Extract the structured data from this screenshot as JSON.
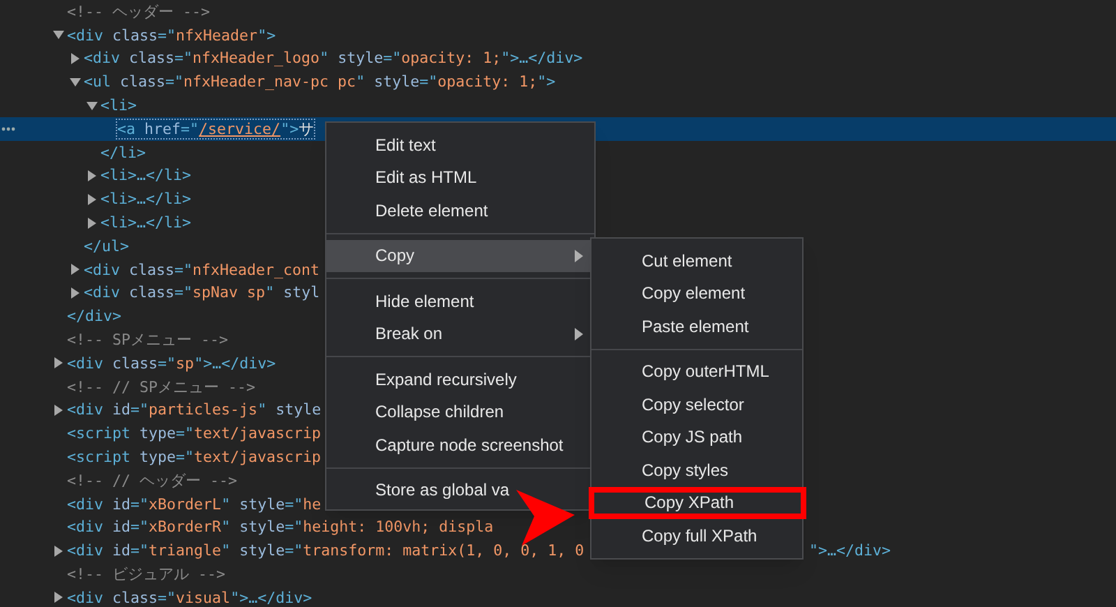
{
  "tree": [
    {
      "tokens": [
        {
          "kind": "comment",
          "text": "<!-- ヘッダー -->"
        }
      ]
    },
    {
      "expanded": true,
      "tokens": [
        {
          "kind": "tag",
          "text": "<div "
        },
        {
          "kind": "attr",
          "text": "class"
        },
        {
          "kind": "tag",
          "text": "=\""
        },
        {
          "kind": "value",
          "text": "nfxHeader"
        },
        {
          "kind": "tag",
          "text": "\">"
        }
      ],
      "close_tokens": [
        {
          "kind": "tag",
          "text": "</div>"
        }
      ],
      "children": [
        {
          "expanded": false,
          "tokens": [
            {
              "kind": "tag",
              "text": "<div "
            },
            {
              "kind": "attr",
              "text": "class"
            },
            {
              "kind": "tag",
              "text": "=\""
            },
            {
              "kind": "value",
              "text": "nfxHeader_logo"
            },
            {
              "kind": "tag",
              "text": "\" "
            },
            {
              "kind": "attr",
              "text": "style"
            },
            {
              "kind": "tag",
              "text": "=\""
            },
            {
              "kind": "value",
              "text": "opacity: 1;"
            },
            {
              "kind": "tag",
              "text": "\">…</div>"
            }
          ]
        },
        {
          "expanded": true,
          "tokens": [
            {
              "kind": "tag",
              "text": "<ul "
            },
            {
              "kind": "attr",
              "text": "class"
            },
            {
              "kind": "tag",
              "text": "=\""
            },
            {
              "kind": "value",
              "text": "nfxHeader_nav-pc pc"
            },
            {
              "kind": "tag",
              "text": "\" "
            },
            {
              "kind": "attr",
              "text": "style"
            },
            {
              "kind": "tag",
              "text": "=\""
            },
            {
              "kind": "value",
              "text": "opacity: 1;"
            },
            {
              "kind": "tag",
              "text": "\">"
            }
          ],
          "close_tokens": [
            {
              "kind": "tag",
              "text": "</ul>"
            }
          ],
          "children": [
            {
              "expanded": true,
              "tokens": [
                {
                  "kind": "tag",
                  "text": "<li>"
                }
              ],
              "close_tokens": [
                {
                  "kind": "tag",
                  "text": "</li>"
                }
              ],
              "children": [
                {
                  "selected": true,
                  "tokens": [
                    {
                      "kind": "tag",
                      "text": "<a "
                    },
                    {
                      "kind": "attr",
                      "text": "href"
                    },
                    {
                      "kind": "tag",
                      "text": "=\""
                    },
                    {
                      "kind": "link",
                      "text": "/service/"
                    },
                    {
                      "kind": "tag",
                      "text": "\">"
                    },
                    {
                      "kind": "text",
                      "text": "サ"
                    }
                  ]
                }
              ]
            },
            {
              "expanded": false,
              "tokens": [
                {
                  "kind": "tag",
                  "text": "<li>…</li>"
                }
              ]
            },
            {
              "expanded": false,
              "tokens": [
                {
                  "kind": "tag",
                  "text": "<li>…</li>"
                }
              ]
            },
            {
              "expanded": false,
              "tokens": [
                {
                  "kind": "tag",
                  "text": "<li>…</li>"
                }
              ]
            }
          ]
        },
        {
          "expanded": false,
          "tokens": [
            {
              "kind": "tag",
              "text": "<div "
            },
            {
              "kind": "attr",
              "text": "class"
            },
            {
              "kind": "tag",
              "text": "=\""
            },
            {
              "kind": "value",
              "text": "nfxHeader_cont"
            }
          ]
        },
        {
          "expanded": false,
          "tokens": [
            {
              "kind": "tag",
              "text": "<div "
            },
            {
              "kind": "attr",
              "text": "class"
            },
            {
              "kind": "tag",
              "text": "=\""
            },
            {
              "kind": "value",
              "text": "spNav sp"
            },
            {
              "kind": "tag",
              "text": "\" "
            },
            {
              "kind": "attr",
              "text": "styl"
            }
          ]
        }
      ]
    },
    {
      "tokens": [
        {
          "kind": "comment",
          "text": "<!-- SPメニュー -->"
        }
      ]
    },
    {
      "expanded": false,
      "tokens": [
        {
          "kind": "tag",
          "text": "<div "
        },
        {
          "kind": "attr",
          "text": "class"
        },
        {
          "kind": "tag",
          "text": "=\""
        },
        {
          "kind": "value",
          "text": "sp"
        },
        {
          "kind": "tag",
          "text": "\">…</div>"
        }
      ]
    },
    {
      "tokens": [
        {
          "kind": "comment",
          "text": "<!-- // SPメニュー -->"
        }
      ]
    },
    {
      "expanded": false,
      "tokens": [
        {
          "kind": "tag",
          "text": "<div "
        },
        {
          "kind": "attr",
          "text": "id"
        },
        {
          "kind": "tag",
          "text": "=\""
        },
        {
          "kind": "value",
          "text": "particles-js"
        },
        {
          "kind": "tag",
          "text": "\" "
        },
        {
          "kind": "attr",
          "text": "style"
        }
      ]
    },
    {
      "tokens": [
        {
          "kind": "tag",
          "text": "<script "
        },
        {
          "kind": "attr",
          "text": "type"
        },
        {
          "kind": "tag",
          "text": "=\""
        },
        {
          "kind": "value",
          "text": "text/javascrip"
        }
      ]
    },
    {
      "tokens": [
        {
          "kind": "tag",
          "text": "<script "
        },
        {
          "kind": "attr",
          "text": "type"
        },
        {
          "kind": "tag",
          "text": "=\""
        },
        {
          "kind": "value",
          "text": "text/javascrip"
        }
      ]
    },
    {
      "tokens": [
        {
          "kind": "comment",
          "text": "<!-- // ヘッダー -->"
        }
      ]
    },
    {
      "tokens": [
        {
          "kind": "tag",
          "text": "<div "
        },
        {
          "kind": "attr",
          "text": "id"
        },
        {
          "kind": "tag",
          "text": "=\""
        },
        {
          "kind": "value",
          "text": "xBorderL"
        },
        {
          "kind": "tag",
          "text": "\" "
        },
        {
          "kind": "attr",
          "text": "style"
        },
        {
          "kind": "tag",
          "text": "=\""
        },
        {
          "kind": "value",
          "text": "he"
        }
      ]
    },
    {
      "tokens": [
        {
          "kind": "tag",
          "text": "<div "
        },
        {
          "kind": "attr",
          "text": "id"
        },
        {
          "kind": "tag",
          "text": "=\""
        },
        {
          "kind": "value",
          "text": "xBorderR"
        },
        {
          "kind": "tag",
          "text": "\" "
        },
        {
          "kind": "attr",
          "text": "style"
        },
        {
          "kind": "tag",
          "text": "=\""
        },
        {
          "kind": "value",
          "text": "height: 100vh; displa"
        }
      ]
    },
    {
      "expanded": false,
      "tokens": [
        {
          "kind": "tag",
          "text": "<div "
        },
        {
          "kind": "attr",
          "text": "id"
        },
        {
          "kind": "tag",
          "text": "=\""
        },
        {
          "kind": "value",
          "text": "triangle"
        },
        {
          "kind": "tag",
          "text": "\" "
        },
        {
          "kind": "attr",
          "text": "style"
        },
        {
          "kind": "tag",
          "text": "=\""
        },
        {
          "kind": "value",
          "text": "transform: matrix(1, 0, 0, 1, 0"
        }
      ],
      "tail_tokens": [
        {
          "kind": "tag",
          "text": "\">…</div>"
        }
      ]
    },
    {
      "tokens": [
        {
          "kind": "comment",
          "text": "<!-- ビジュアル -->"
        }
      ]
    },
    {
      "expanded": false,
      "tokens": [
        {
          "kind": "tag",
          "text": "<div "
        },
        {
          "kind": "attr",
          "text": "class"
        },
        {
          "kind": "tag",
          "text": "=\""
        },
        {
          "kind": "value",
          "text": "visual"
        },
        {
          "kind": "tag",
          "text": "\">…</div>"
        }
      ]
    }
  ],
  "context_menu": [
    {
      "kind": "item",
      "label": "Edit text",
      "highlighted": false,
      "submenu": false
    },
    {
      "kind": "item",
      "label": "Edit as HTML",
      "highlighted": false,
      "submenu": false
    },
    {
      "kind": "item",
      "label": "Delete element",
      "highlighted": false,
      "submenu": false
    },
    {
      "kind": "separator"
    },
    {
      "kind": "item",
      "label": "Copy",
      "highlighted": true,
      "submenu": true
    },
    {
      "kind": "separator"
    },
    {
      "kind": "item",
      "label": "Hide element",
      "highlighted": false,
      "submenu": false
    },
    {
      "kind": "item",
      "label": "Break on",
      "highlighted": false,
      "submenu": true
    },
    {
      "kind": "separator"
    },
    {
      "kind": "item",
      "label": "Expand recursively",
      "highlighted": false,
      "submenu": false
    },
    {
      "kind": "item",
      "label": "Collapse children",
      "highlighted": false,
      "submenu": false
    },
    {
      "kind": "item",
      "label": "Capture node screenshot",
      "highlighted": false,
      "submenu": false
    },
    {
      "kind": "separator"
    },
    {
      "kind": "item",
      "label": "Store as global va",
      "highlighted": false,
      "submenu": false
    }
  ],
  "copy_submenu": [
    {
      "kind": "item",
      "label": "Cut element",
      "marked": false
    },
    {
      "kind": "item",
      "label": "Copy element",
      "marked": false
    },
    {
      "kind": "item",
      "label": "Paste element",
      "marked": false
    },
    {
      "kind": "separator"
    },
    {
      "kind": "item",
      "label": "Copy outerHTML",
      "marked": false
    },
    {
      "kind": "item",
      "label": "Copy selector",
      "marked": false
    },
    {
      "kind": "item",
      "label": "Copy JS path",
      "marked": false
    },
    {
      "kind": "item",
      "label": "Copy styles",
      "marked": false
    },
    {
      "kind": "item",
      "label": "Copy XPath",
      "marked": true
    },
    {
      "kind": "item",
      "label": "Copy full XPath",
      "marked": false
    }
  ]
}
